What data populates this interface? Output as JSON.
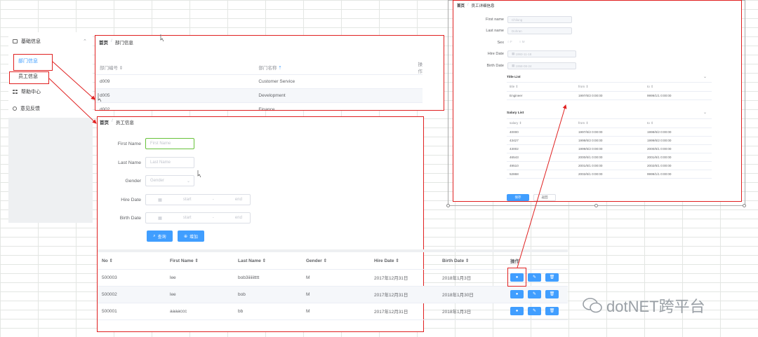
{
  "sidebar": {
    "items": [
      {
        "label": "基础信息"
      },
      {
        "label": "帮助中心"
      },
      {
        "label": "意见反馈"
      }
    ],
    "sub_items": [
      {
        "label": "部门信息"
      },
      {
        "label": "员工信息"
      }
    ]
  },
  "dept_panel": {
    "breadcrumb": {
      "home": "首页",
      "sep": "/",
      "current": "部门信息"
    },
    "columns": [
      "部门编号",
      "部门名称",
      "操作"
    ],
    "rows": [
      {
        "no": "d009",
        "name": "Customer Service"
      },
      {
        "no": "d005",
        "name": "Development"
      },
      {
        "no": "d002",
        "name": "Finance"
      }
    ]
  },
  "emp_panel": {
    "breadcrumb": {
      "home": "首页",
      "sep": "/",
      "current": "员工信息"
    },
    "form": {
      "first_name": {
        "label": "First Name",
        "placeholder": "First Name"
      },
      "last_name": {
        "label": "Last Name",
        "placeholder": "Last Name"
      },
      "gender": {
        "label": "Gender",
        "placeholder": "Gender"
      },
      "hire_date": {
        "label": "Hire Date",
        "start": "start",
        "dash": "-",
        "end": "end"
      },
      "birth_date": {
        "label": "Birth Date",
        "start": "start",
        "dash": "-",
        "end": "end"
      }
    },
    "buttons": {
      "search": "查询",
      "add": "增加"
    },
    "columns": [
      "No",
      "First Name",
      "Last Name",
      "Gender",
      "Hire Date",
      "Birth Date",
      "操作"
    ],
    "rows": [
      {
        "no": "500003",
        "first": "lee",
        "last": "bob3iiiiiitttt",
        "gender": "M",
        "hire": "2017年12月31日",
        "birth": "2018年1月3日"
      },
      {
        "no": "500002",
        "first": "lee",
        "last": "bob",
        "gender": "M",
        "hire": "2017年12月31日",
        "birth": "2018年1月30日"
      },
      {
        "no": "500001",
        "first": "aaaaccc",
        "last": "bb",
        "gender": "M",
        "hire": "2017年12月31日",
        "birth": "2018年1月3日"
      }
    ]
  },
  "detail_panel": {
    "breadcrumb": {
      "home": "首页",
      "sep": "/",
      "current": "员工详细信息"
    },
    "fields": {
      "first_name": {
        "label": "First name",
        "value": "Chilung"
      },
      "last_name": {
        "label": "Last name",
        "value": "Dohran"
      },
      "sex": {
        "label": "Sex",
        "f": "F",
        "m": "M"
      },
      "hire_date": {
        "label": "Hire Date",
        "value": "1993-11-18"
      },
      "birth_date": {
        "label": "Birth Date",
        "value": "1958-08-24"
      }
    },
    "title_list": {
      "heading": "Title List",
      "columns": [
        "title",
        "from",
        "to"
      ],
      "rows": [
        {
          "title": "Engineer",
          "from": "1997/6/2 0:00:00",
          "to": "9999/1/1 0:00:00"
        }
      ]
    },
    "salary_list": {
      "heading": "Salary List",
      "columns": [
        "salary",
        "from",
        "to"
      ],
      "rows": [
        {
          "salary": "40000",
          "from": "1997/6/2 0:00:00",
          "to": "1998/6/2 0:00:00"
        },
        {
          "salary": "43427",
          "from": "1998/6/2 0:00:00",
          "to": "1999/6/2 0:00:00"
        },
        {
          "salary": "43002",
          "from": "1999/6/2 0:00:00",
          "to": "2000/6/1 0:00:00"
        },
        {
          "salary": "46543",
          "from": "2000/6/1 0:00:00",
          "to": "2001/6/1 0:00:00"
        },
        {
          "salary": "49510",
          "from": "2001/6/1 0:00:00",
          "to": "2002/6/1 0:00:00"
        },
        {
          "salary": "52868",
          "from": "2002/6/1 0:00:00",
          "to": "9999/1/1 0:00:00"
        }
      ]
    },
    "buttons": {
      "save": "保存",
      "back": "返回"
    }
  },
  "watermark": {
    "text": "dotNET跨平台"
  },
  "colors": {
    "primary": "#409eff",
    "annotation_red": "#e02020",
    "focus_green": "#67c23a"
  }
}
